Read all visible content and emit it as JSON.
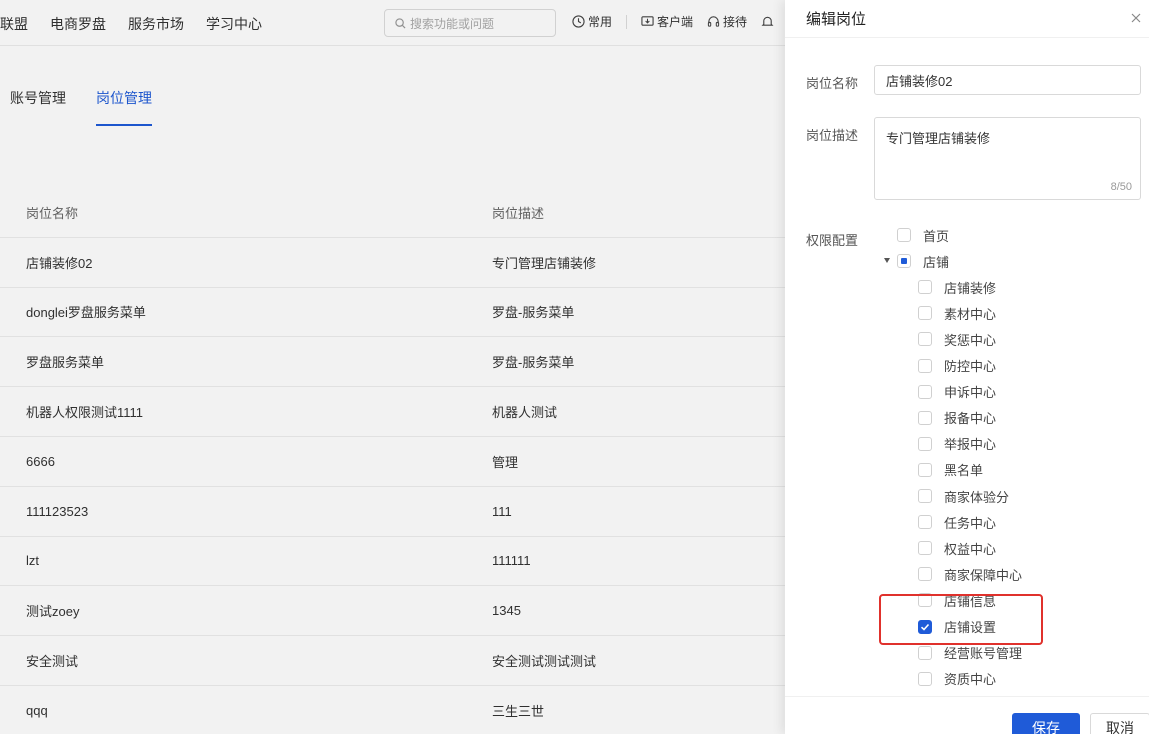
{
  "topnav": [
    "联盟",
    "电商罗盘",
    "服务市场",
    "学习中心"
  ],
  "search": {
    "placeholder": "搜索功能或问题"
  },
  "tools": [
    {
      "label": "常用",
      "icon": "clock-icon"
    },
    {
      "label": "客户端",
      "icon": "download-icon"
    },
    {
      "label": "接待",
      "icon": "headset-icon"
    }
  ],
  "tabs": [
    {
      "label": "账号管理",
      "active": false
    },
    {
      "label": "岗位管理",
      "active": true
    }
  ],
  "table": {
    "headers": [
      "岗位名称",
      "岗位描述"
    ],
    "rows": [
      [
        "店铺装修02",
        "专门管理店铺装修"
      ],
      [
        "donglei罗盘服务菜单",
        "罗盘-服务菜单"
      ],
      [
        "罗盘服务菜单",
        "罗盘-服务菜单"
      ],
      [
        "机器人权限测试1111",
        "机器人测试"
      ],
      [
        "6666",
        "管理"
      ],
      [
        "111123523",
        "111"
      ],
      [
        "lzt",
        "111111"
      ],
      [
        "测试zoey",
        "1345"
      ],
      [
        "安全测试",
        "安全测试测试测试"
      ],
      [
        "qqq",
        "三生三世"
      ]
    ]
  },
  "drawer": {
    "title": "编辑岗位",
    "name_label": "岗位名称",
    "name_value": "店铺装修02",
    "desc_label": "岗位描述",
    "desc_value": "专门管理店铺装修",
    "desc_counter": "8/50",
    "perm_label": "权限配置",
    "save_label": "保存",
    "cancel_label": "取消"
  },
  "tree": [
    {
      "label": "首页",
      "level": 0,
      "state": "unchecked"
    },
    {
      "label": "店铺",
      "level": 0,
      "state": "indeterminate",
      "expanded": true
    },
    {
      "label": "店铺装修",
      "level": 1,
      "state": "unchecked"
    },
    {
      "label": "素材中心",
      "level": 1,
      "state": "unchecked"
    },
    {
      "label": "奖惩中心",
      "level": 1,
      "state": "unchecked"
    },
    {
      "label": "防控中心",
      "level": 1,
      "state": "unchecked"
    },
    {
      "label": "申诉中心",
      "level": 1,
      "state": "unchecked"
    },
    {
      "label": "报备中心",
      "level": 1,
      "state": "unchecked"
    },
    {
      "label": "举报中心",
      "level": 1,
      "state": "unchecked"
    },
    {
      "label": "黑名单",
      "level": 1,
      "state": "unchecked"
    },
    {
      "label": "商家体验分",
      "level": 1,
      "state": "unchecked"
    },
    {
      "label": "任务中心",
      "level": 1,
      "state": "unchecked"
    },
    {
      "label": "权益中心",
      "level": 1,
      "state": "unchecked"
    },
    {
      "label": "商家保障中心",
      "level": 1,
      "state": "unchecked"
    },
    {
      "label": "店铺信息",
      "level": 1,
      "state": "unchecked"
    },
    {
      "label": "店铺设置",
      "level": 1,
      "state": "checked"
    },
    {
      "label": "经营账号管理",
      "level": 1,
      "state": "unchecked"
    },
    {
      "label": "资质中心",
      "level": 1,
      "state": "unchecked"
    }
  ],
  "colors": {
    "accent": "#1f5bd8",
    "highlight": "#e0312c"
  }
}
